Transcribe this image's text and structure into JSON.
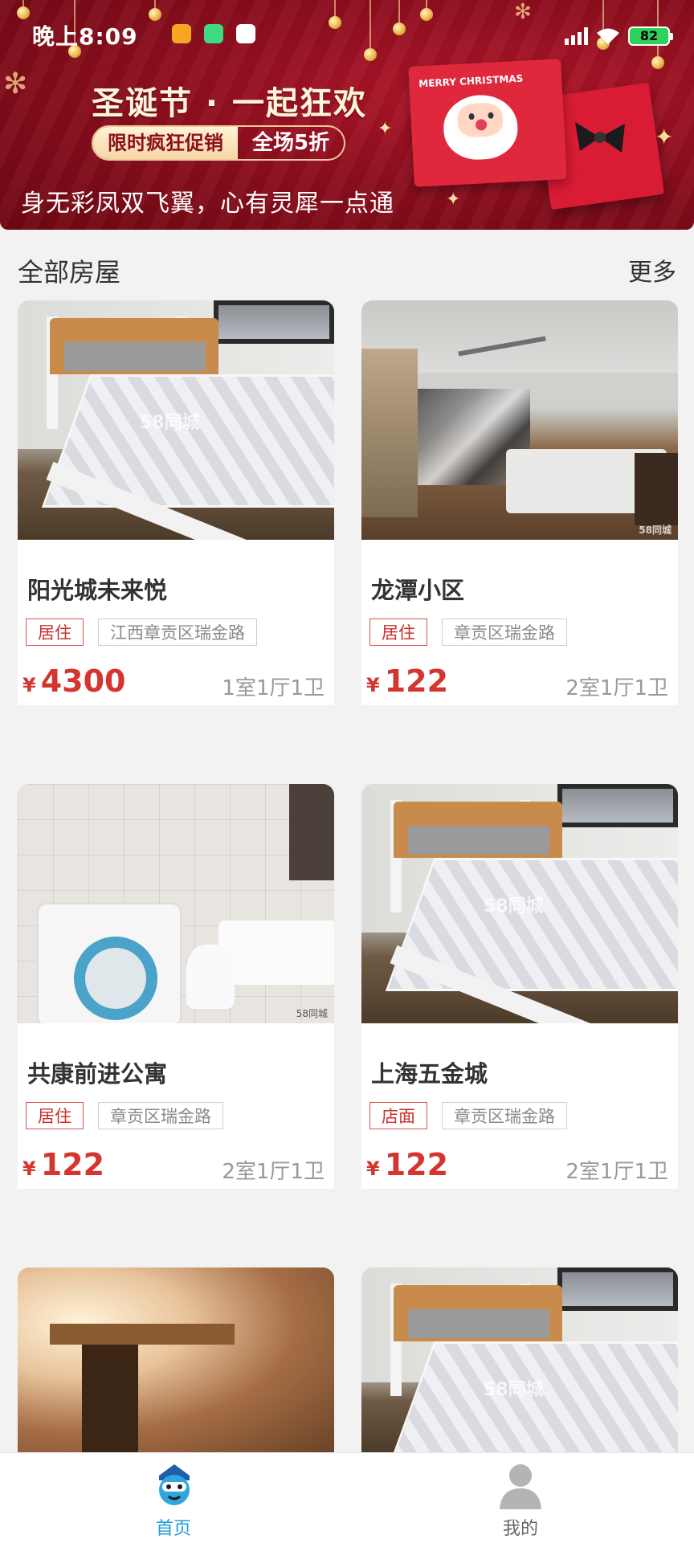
{
  "status": {
    "time": "晚上8:09",
    "battery": "82"
  },
  "banner": {
    "headline": "圣诞节 · 一起狂欢",
    "promo_left": "限时疯狂促销",
    "promo_right": "全场5折",
    "slogan": "身无彩凤双飞翼，心有灵犀一点通",
    "card_text": "MERRY CHRISTMAS"
  },
  "section": {
    "title": "全部房屋",
    "more": "更多"
  },
  "listings": [
    {
      "name": "阳光城未来悦",
      "type": "居住",
      "address": "江西章贡区瑞金路",
      "currency": "¥",
      "price": "4300",
      "layout": "1室1厅1卫",
      "photo": "bedroom"
    },
    {
      "name": "龙潭小区",
      "type": "居住",
      "address": "章贡区瑞金路",
      "currency": "¥",
      "price": "122",
      "layout": "2室1厅1卫",
      "photo": "living-room"
    },
    {
      "name": "共康前进公寓",
      "type": "居住",
      "address": "章贡区瑞金路",
      "currency": "¥",
      "price": "122",
      "layout": "2室1厅1卫",
      "photo": "bathroom"
    },
    {
      "name": "上海五金城",
      "type": "店面",
      "address": "章贡区瑞金路",
      "currency": "¥",
      "price": "122",
      "layout": "2室1厅1卫",
      "photo": "bedroom"
    },
    {
      "name": "",
      "photo": "interior-blurry"
    },
    {
      "name": "",
      "photo": "bedroom"
    }
  ],
  "watermark": "58同城",
  "tabs": [
    {
      "label": "首页",
      "icon": "home-icon",
      "active": true
    },
    {
      "label": "我的",
      "icon": "user-icon",
      "active": false
    }
  ],
  "colors": {
    "banner_red": "#8e0e1e",
    "price_red": "#d4352f",
    "tab_active": "#1f9bd5",
    "background": "#f2f2f2"
  }
}
